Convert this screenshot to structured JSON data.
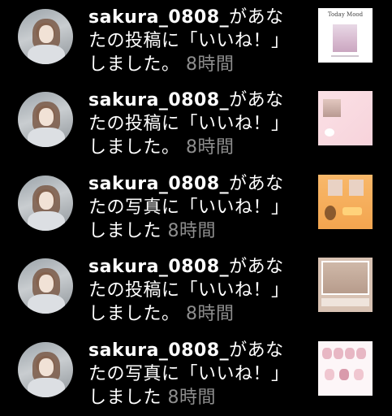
{
  "notifications": [
    {
      "username": "sakura_0808_",
      "message": "があなたの投稿に「いいね！」しました。",
      "time": "8時間",
      "thumbnail_caption": "Today Mood"
    },
    {
      "username": "sakura_0808_",
      "message": "があなたの投稿に「いいね！」しました。",
      "time": "8時間",
      "thumbnail_caption": ""
    },
    {
      "username": "sakura_0808_",
      "message": "があなたの写真に「いいね！」しました",
      "time": "8時間",
      "thumbnail_caption": ""
    },
    {
      "username": "sakura_0808_",
      "message": "があなたの投稿に「いいね！」しました。",
      "time": "8時間",
      "thumbnail_caption": ""
    },
    {
      "username": "sakura_0808_",
      "message": "があなたの写真に「いいね！」しました",
      "time": "8時間",
      "thumbnail_caption": ""
    }
  ],
  "colors": {
    "background": "#000000",
    "text": "#ffffff",
    "timestamp": "#8e8e8e"
  }
}
